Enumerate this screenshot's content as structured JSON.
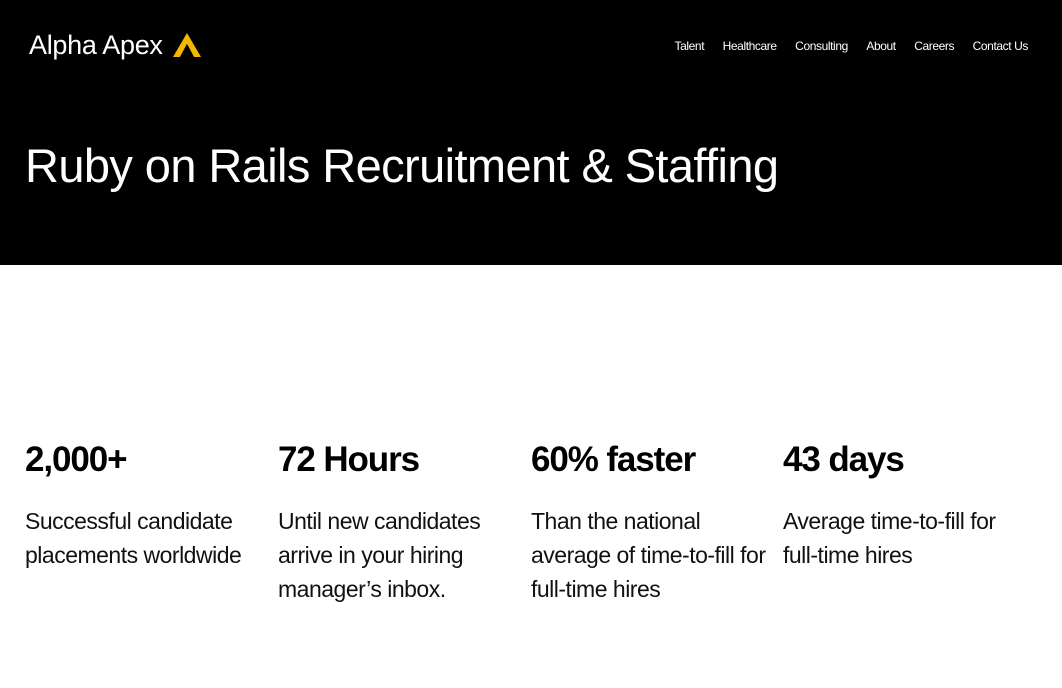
{
  "brand": {
    "name": "Alpha Apex",
    "accent_color": "#F5B800",
    "icon": "apex-triangle-icon"
  },
  "nav": {
    "items": [
      {
        "label": "Talent"
      },
      {
        "label": "Healthcare"
      },
      {
        "label": "Consulting"
      },
      {
        "label": "About"
      },
      {
        "label": "Careers"
      },
      {
        "label": "Contact Us"
      }
    ]
  },
  "hero": {
    "title": "Ruby on Rails Recruitment & Staffing",
    "background": "#000000"
  },
  "stats": [
    {
      "value": "2,000+",
      "description": "Successful candidate placements worldwide"
    },
    {
      "value": "72 Hours",
      "description": "Until new candidates arrive in your hiring manager’s inbox."
    },
    {
      "value": "60% faster",
      "description": "Than the national average of time-to-fill for full-time hires"
    },
    {
      "value": "43 days",
      "description": "Average time-to-fill for full-time hires"
    }
  ]
}
